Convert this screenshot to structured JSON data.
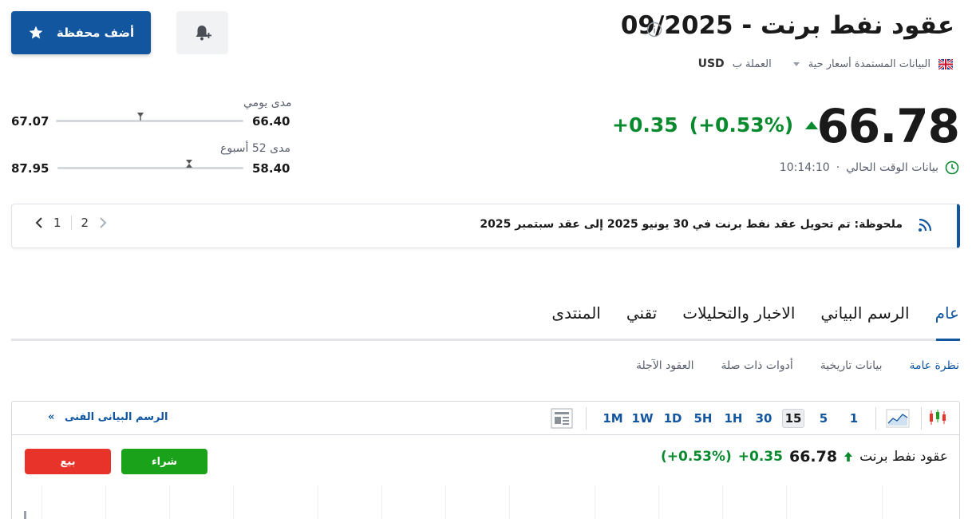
{
  "header": {
    "title": "عقود نفط برنت - 09/2025",
    "data_source": "البيانات المستمدة أسعار حية",
    "currency_label": "العملة ب",
    "currency": "USD"
  },
  "actions": {
    "add_portfolio": "أضف محفظة"
  },
  "quote": {
    "price": "66.78",
    "change": "+0.35",
    "change_pct": "(+0.53%)",
    "time_label": "بيانات الوقت الحالي",
    "time": "10:14:10",
    "up_color": "#0a8a2f"
  },
  "ranges": {
    "daily": {
      "label": "مدى يومي",
      "low": "66.40",
      "high": "67.07",
      "position": 0.55
    },
    "week52": {
      "label": "مدى 52 أسبوع",
      "low": "58.40",
      "high": "87.95",
      "position": 0.29
    }
  },
  "note": {
    "text": "ملحوظة: تم تحويل عقد نفط برنت في 30 يونيو 2025 إلى عقد سبتمبر 2025",
    "page_current": "1",
    "page_next": "2"
  },
  "tabs": [
    "عام",
    "الرسم البياني",
    "الاخبار والتحليلات",
    "تقني",
    "المنتدى"
  ],
  "subtabs": [
    "نظرة عامة",
    "بيانات تاريخية",
    "أدوات ذات صلة",
    "العقود الآجلة"
  ],
  "chart": {
    "timeframes": [
      "1",
      "5",
      "15",
      "30",
      "1H",
      "5H",
      "1D",
      "1W",
      "1M"
    ],
    "active_timeframe": "15",
    "technical_link": "الرسم البيانى الفنى",
    "technical_link_arrow": "»",
    "title_name": "عقود نفط برنت",
    "price": "66.78",
    "change": "+0.35",
    "change_pct": "(+0.53%)",
    "buy_label": "شراء",
    "sell_label": "بيع",
    "buy_color": "#1aa31a",
    "sell_color": "#e8332b"
  },
  "brand_color": "#1256a0"
}
